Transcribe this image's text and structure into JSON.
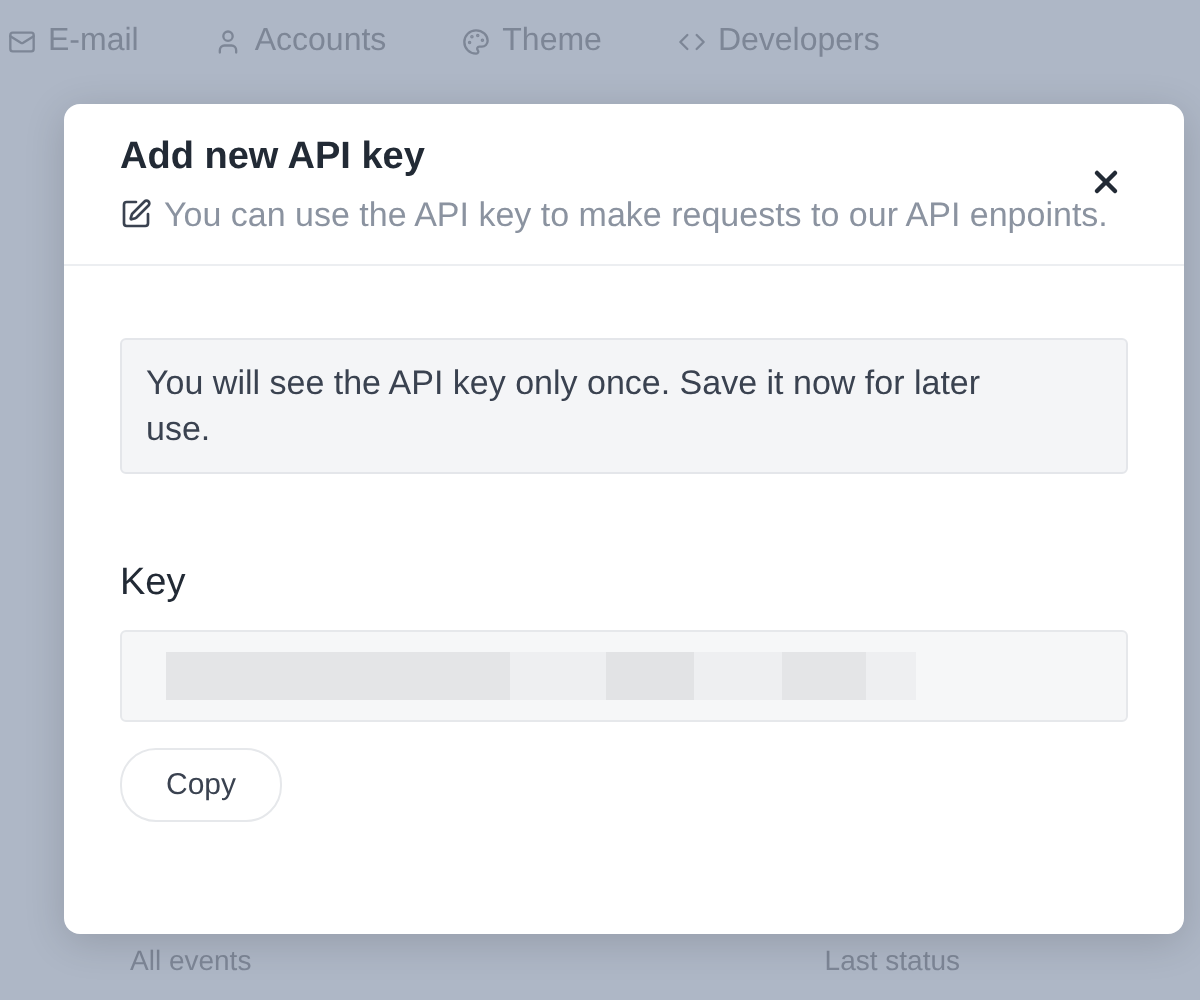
{
  "background_tabs": [
    {
      "label": "E-mail"
    },
    {
      "label": "Accounts"
    },
    {
      "label": "Theme"
    },
    {
      "label": "Developers"
    }
  ],
  "background_columns": [
    "All events",
    "Last status"
  ],
  "dialog": {
    "title": "Add new API key",
    "subtitle": "You can use the API key to make requests to our API enpoints.",
    "notice": "You will see the API key only once. Save it now for later use.",
    "field_label": "Key",
    "button": "Copy"
  }
}
